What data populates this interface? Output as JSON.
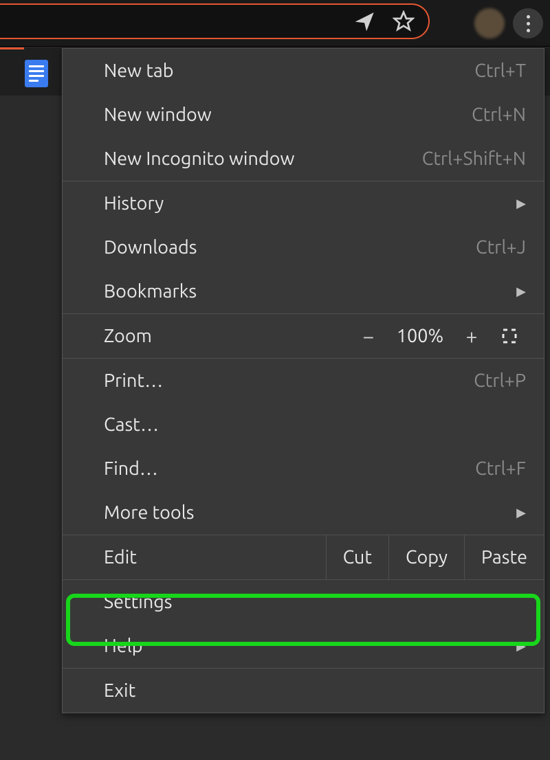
{
  "toolbar": {
    "send_icon": "send-icon",
    "star_icon": "star-icon",
    "avatar": "profile-avatar",
    "kebab": "browser-menu"
  },
  "menu": {
    "new_tab": {
      "label": "New tab",
      "shortcut": "Ctrl+T"
    },
    "new_window": {
      "label": "New window",
      "shortcut": "Ctrl+N"
    },
    "new_incognito": {
      "label": "New Incognito window",
      "shortcut": "Ctrl+Shift+N"
    },
    "history": {
      "label": "History"
    },
    "downloads": {
      "label": "Downloads",
      "shortcut": "Ctrl+J"
    },
    "bookmarks": {
      "label": "Bookmarks"
    },
    "zoom": {
      "label": "Zoom",
      "value": "100%",
      "minus": "−",
      "plus": "+"
    },
    "print": {
      "label": "Print…",
      "shortcut": "Ctrl+P"
    },
    "cast": {
      "label": "Cast…"
    },
    "find": {
      "label": "Find…",
      "shortcut": "Ctrl+F"
    },
    "more_tools": {
      "label": "More tools"
    },
    "edit": {
      "label": "Edit",
      "cut": "Cut",
      "copy": "Copy",
      "paste": "Paste"
    },
    "settings": {
      "label": "Settings"
    },
    "help": {
      "label": "Help"
    },
    "exit": {
      "label": "Exit"
    }
  }
}
